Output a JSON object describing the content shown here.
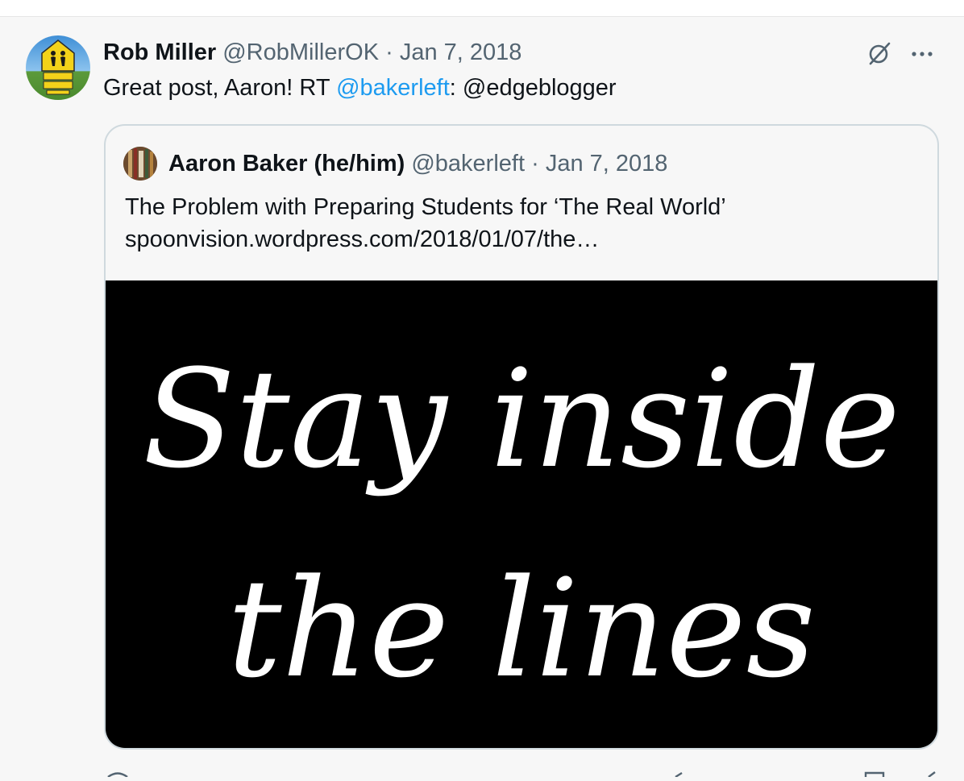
{
  "tweet": {
    "author_name": "Rob Miller",
    "author_handle": "@RobMillerOK",
    "separator": "·",
    "date": "Jan 7, 2018",
    "text_before": "Great post, Aaron! RT ",
    "mention_link": "@bakerleft",
    "text_after": ": @edgeblogger",
    "icons": {
      "grok": "grok-slash-icon",
      "more": "more-dots-icon"
    }
  },
  "quote": {
    "author_name": "Aaron Baker (he/him)",
    "author_handle": "@bakerleft",
    "separator": "·",
    "date": "Jan 7, 2018",
    "line1": "The Problem with Preparing Students for ‘The Real World’",
    "line2": "spoonvision.wordpress.com/2018/01/07/the…",
    "image_text_line1": "Stay inside",
    "image_text_line2": "the lines"
  },
  "colors": {
    "link": "#1d9bf0",
    "muted": "#536471",
    "text": "#0f1419",
    "background": "#f7f7f7",
    "border": "#cfd9de"
  }
}
